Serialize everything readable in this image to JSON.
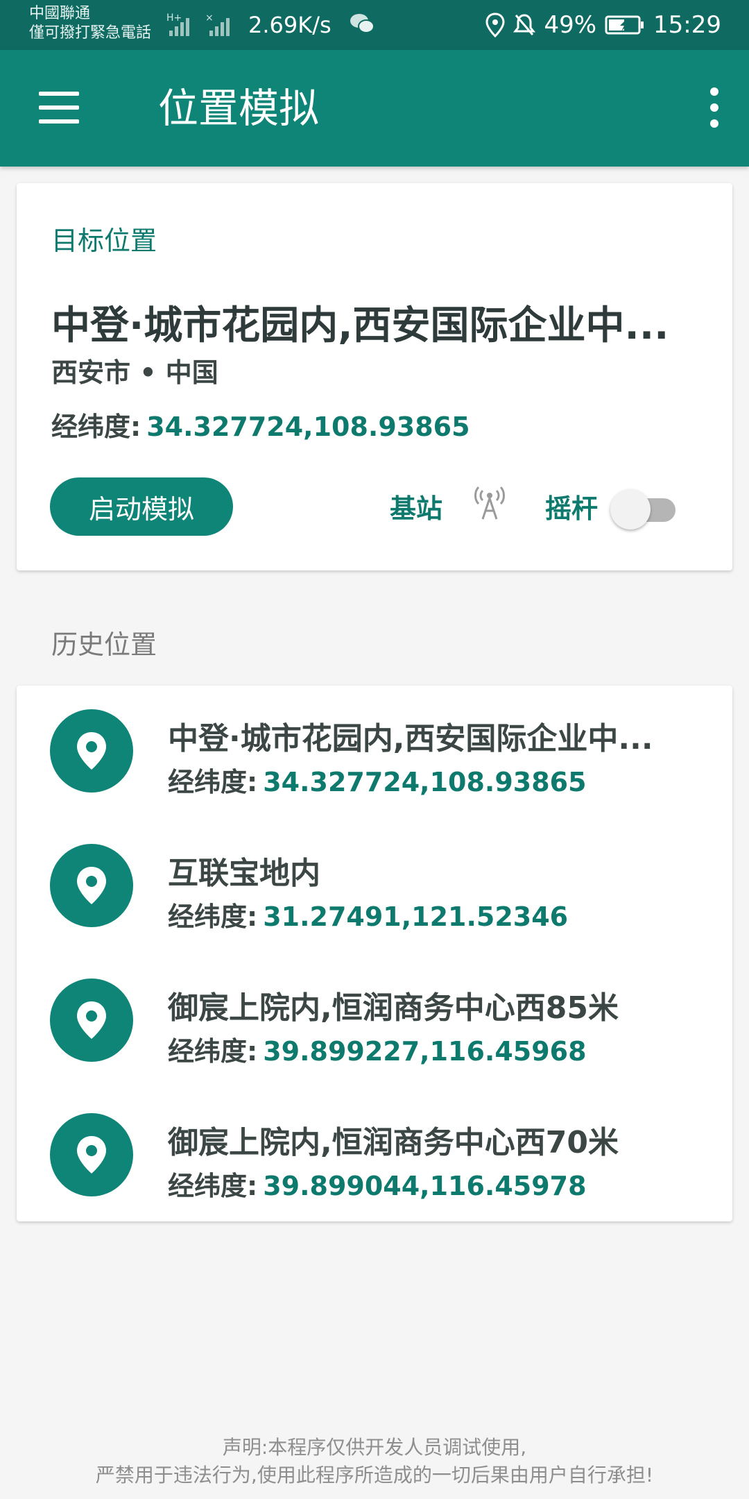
{
  "status_bar": {
    "carrier_line1": "中國聯通",
    "carrier_line2": "僅可撥打緊急電話",
    "net_speed": "2.69K/s",
    "battery": "49%",
    "time": "15:29",
    "icons": [
      "signal-icon",
      "wechat-icon",
      "location-icon",
      "mute-icon",
      "battery-icon"
    ]
  },
  "toolbar": {
    "title": "位置模拟",
    "icons": [
      "menu-icon",
      "more-icon"
    ]
  },
  "target": {
    "section_label": "目标位置",
    "name": "中登·城市花园内,西安国际企业中...",
    "city": "西安市 • 中国",
    "coord_label": "经纬度:",
    "coord_value": "34.327724,108.93865",
    "start_button": "启动模拟",
    "cell_label": "基站",
    "joystick_label": "摇杆",
    "joystick_enabled": false
  },
  "history": {
    "section_label": "历史位置",
    "coord_label": "经纬度:",
    "items": [
      {
        "name": "中登·城市花园内,西安国际企业中...",
        "coord": "34.327724,108.93865"
      },
      {
        "name": "互联宝地内",
        "coord": "31.27491,121.52346"
      },
      {
        "name": "御宸上院内,恒润商务中心西85米",
        "coord": "39.899227,116.45968"
      },
      {
        "name": "御宸上院内,恒润商务中心西70米",
        "coord": "39.899044,116.45978"
      }
    ]
  },
  "footer": {
    "line1": "声明:本程序仅供开发人员调试使用,",
    "line2": "严禁用于违法行为,使用此程序所造成的一切后果由用户自行承担!"
  },
  "colors": {
    "primary": "#0e8577",
    "status_bar": "#0f6b62",
    "accent_text": "#0e7a6e"
  }
}
